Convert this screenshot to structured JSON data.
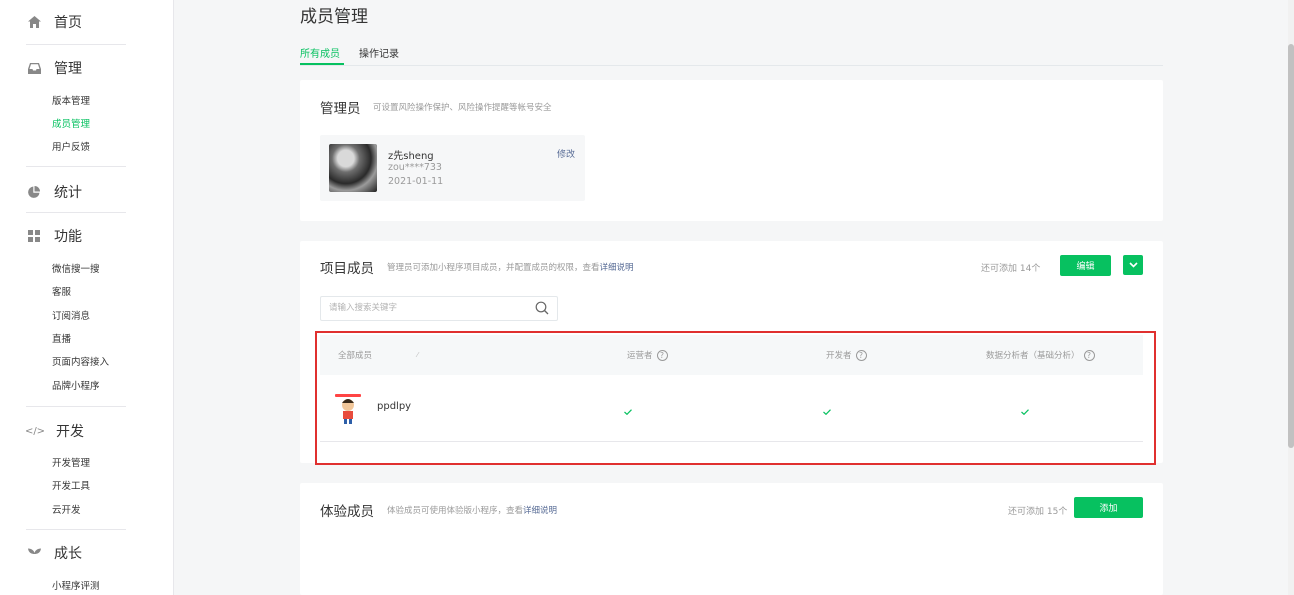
{
  "sidebar": {
    "home": "首页",
    "manage": {
      "label": "管理",
      "items": [
        "版本管理",
        "成员管理",
        "用户反馈"
      ]
    },
    "stats": "统计",
    "features": {
      "label": "功能",
      "items": [
        "微信搜一搜",
        "客服",
        "订阅消息",
        "直播",
        "页面内容接入",
        "品牌小程序"
      ]
    },
    "dev": {
      "label": "开发",
      "items": [
        "开发管理",
        "开发工具",
        "云开发"
      ]
    },
    "growth": {
      "label": "成长",
      "items": [
        "小程序评测"
      ]
    }
  },
  "page": {
    "title": "成员管理",
    "tabs": [
      "所有成员",
      "操作记录"
    ]
  },
  "admin_card": {
    "title": "管理员",
    "desc": "可设置风险操作保护、风险操作提醒等帐号安全",
    "name": "z先sheng",
    "account": "zou****733",
    "date": "2021-01-11",
    "edit": "修改"
  },
  "project_card": {
    "title": "项目成员",
    "desc": "管理员可添加小程序项目成员，并配置成员的权限，查看",
    "desc_link": "详细说明",
    "remain": "还可添加 14个",
    "edit_button": "编辑",
    "search_placeholder": "请输入搜索关键字",
    "columns": [
      "全部成员",
      "运营者",
      "开发者",
      "数据分析者（基础分析）"
    ],
    "rows": [
      {
        "name": "ppdlpy",
        "operator": "✓",
        "developer": "✓",
        "analyst": "✓"
      }
    ]
  },
  "trial_card": {
    "title": "体验成员",
    "desc": "体验成员可使用体验版小程序，查看",
    "desc_link": "详细说明",
    "remain": "还可添加 15个",
    "add_button": "添加"
  },
  "colors": {
    "accent": "#07c160",
    "link": "#576b95",
    "highlight": "#e0302f"
  }
}
